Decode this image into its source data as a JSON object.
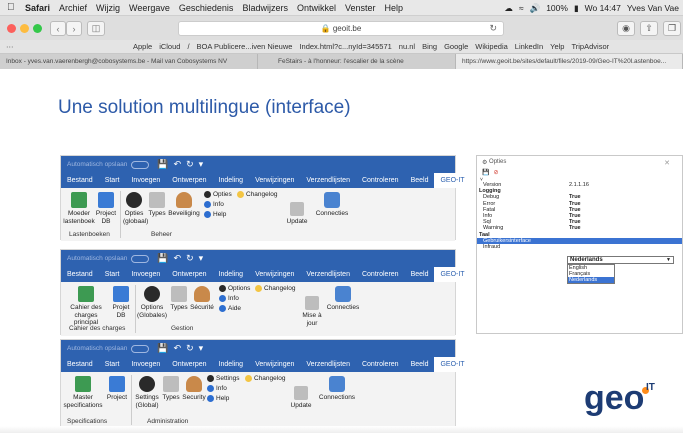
{
  "menubar": {
    "items": [
      "Safari",
      "Archief",
      "Wijzig",
      "Weergave",
      "Geschiedenis",
      "Bladwijzers",
      "Ontwikkel",
      "Venster",
      "Help"
    ],
    "status": {
      "battery": "100%",
      "clock": "Wo 14:47",
      "user": "Yves Van Vae"
    }
  },
  "browser": {
    "url": "geoit.be",
    "favorites": [
      "Apple",
      "iCloud",
      "/",
      "BOA Publicere...iven Nieuwe",
      "Index.html?c...nyId=345571",
      "nu.nl",
      "Bing",
      "Google",
      "Wikipedia",
      "LinkedIn",
      "Yelp",
      "TripAdvisor"
    ],
    "tabs": [
      "Inbox - yves.van.vaerenbergh@cobosystems.be - Mail van Cobosystems NV",
      "FeStairs - à l'honneur: l'escalier de la scène",
      "https://www.geoit.be/sites/default/files/2019-09/Geo-IT%20l.astenboe..."
    ]
  },
  "slide": {
    "title": "Une solution multilingue (interface)"
  },
  "ribbons": [
    {
      "autosave": "Automatisch opslaan",
      "tabs": [
        "Bestand",
        "Start",
        "Invoegen",
        "Ontwerpen",
        "Indeling",
        "Verwijzingen",
        "Verzendlijsten",
        "Controleren",
        "Beeld",
        "GEO-IT"
      ],
      "buttons": {
        "b1": "Moeder lastenboek",
        "b2": "Project DB",
        "b3": "Opties (globaal)",
        "b4": "Types",
        "b5": "Beveiliging",
        "b6": "Update",
        "b7": "Connecties"
      },
      "small": {
        "opties": "Opties",
        "changelog": "Changelog",
        "info": "Info",
        "help": "Help"
      },
      "groups": {
        "g1": "Lastenboeken",
        "g2": "Beheer"
      }
    },
    {
      "autosave": "Automatisch opslaan",
      "tabs": [
        "Bestand",
        "Start",
        "Invoegen",
        "Ontwerpen",
        "Indeling",
        "Verwijzingen",
        "Verzendlijsten",
        "Controleren",
        "Beeld",
        "GEO-IT"
      ],
      "buttons": {
        "b1": "Cahier des charges principal",
        "b2": "Projet DB",
        "b3": "Options (Globales)",
        "b4": "Types",
        "b5": "Sécurité",
        "b6": "Mise à jour",
        "b7": "Connecties"
      },
      "small": {
        "opties": "Options",
        "changelog": "Changelog",
        "info": "Info",
        "help": "Aide"
      },
      "groups": {
        "g1": "Cahier des charges",
        "g2": "Gestion"
      }
    },
    {
      "autosave": "Automatisch opslaan",
      "tabs": [
        "Bestand",
        "Start",
        "Invoegen",
        "Ontwerpen",
        "Indeling",
        "Verwijzingen",
        "Verzendlijsten",
        "Controleren",
        "Beeld",
        "GEO-IT"
      ],
      "buttons": {
        "b1": "Master specifications",
        "b2": "Project",
        "b3": "Settings (Global)",
        "b4": "Types",
        "b5": "Security",
        "b6": "Update",
        "b7": "Connections"
      },
      "small": {
        "opties": "Settings",
        "changelog": "Changelog",
        "info": "Info",
        "help": "Help"
      },
      "groups": {
        "g1": "Specifications",
        "g2": "Administration"
      }
    }
  ],
  "opties": {
    "title": "Opties",
    "rows": [
      {
        "k": "Version",
        "v": "2.1.1.16",
        "g": false
      },
      {
        "k": "Logging",
        "v": "",
        "g": true
      },
      {
        "k": "Debug",
        "v": "True",
        "g": false
      },
      {
        "k": "Error",
        "v": "True",
        "g": false
      },
      {
        "k": "Fatal",
        "v": "True",
        "g": false
      },
      {
        "k": "Info",
        "v": "True",
        "g": false
      },
      {
        "k": "Sql",
        "v": "True",
        "g": false
      },
      {
        "k": "Warning",
        "v": "True",
        "g": false
      },
      {
        "k": "Taal",
        "v": "",
        "g": true
      },
      {
        "k": "Gebruikersinterface",
        "v": "",
        "g": false
      },
      {
        "k": "Infraud",
        "v": "",
        "g": false
      }
    ],
    "taal_selected": "Nederlands",
    "taal_options": [
      "English",
      "Français",
      "Nederlands"
    ]
  },
  "logo": {
    "text": "geo",
    "sup": "IT"
  }
}
